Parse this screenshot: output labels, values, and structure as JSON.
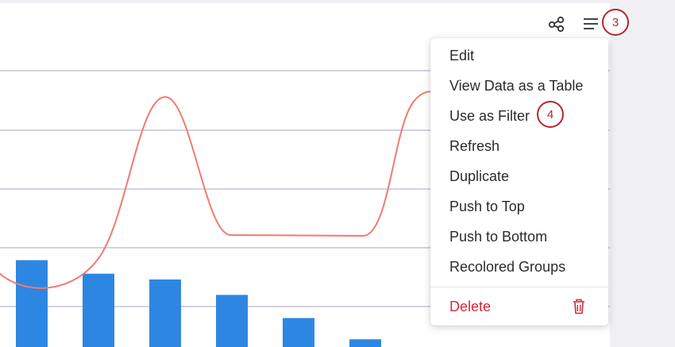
{
  "toolbar": {
    "share_icon": "share-icon",
    "menu_icon": "hamburger-menu-icon",
    "step_badge_menu": "3"
  },
  "context_menu": {
    "items": [
      {
        "label": "Edit"
      },
      {
        "label": "View Data as a Table"
      },
      {
        "label": "Use as Filter",
        "step_badge": "4"
      },
      {
        "label": "Refresh"
      },
      {
        "label": "Duplicate"
      },
      {
        "label": "Push to Top"
      },
      {
        "label": "Push to Bottom"
      },
      {
        "label": "Recolored Groups"
      }
    ],
    "delete_label": "Delete",
    "delete_icon": "trash-icon"
  },
  "colors": {
    "bar": "#2d87e2",
    "line": "#f07b6f",
    "gridline": "#b9b9cc",
    "delete": "#d62839",
    "badge": "#b8242f"
  },
  "chart_data": {
    "type": "bar",
    "note_visible_portion_only": false,
    "bars": [
      0.9,
      0.76,
      0.7,
      0.54,
      0.3,
      0.08
    ],
    "line": [
      0.1,
      0.3,
      0.98,
      0.46,
      0.46,
      0.98
    ],
    "grid": true
  }
}
